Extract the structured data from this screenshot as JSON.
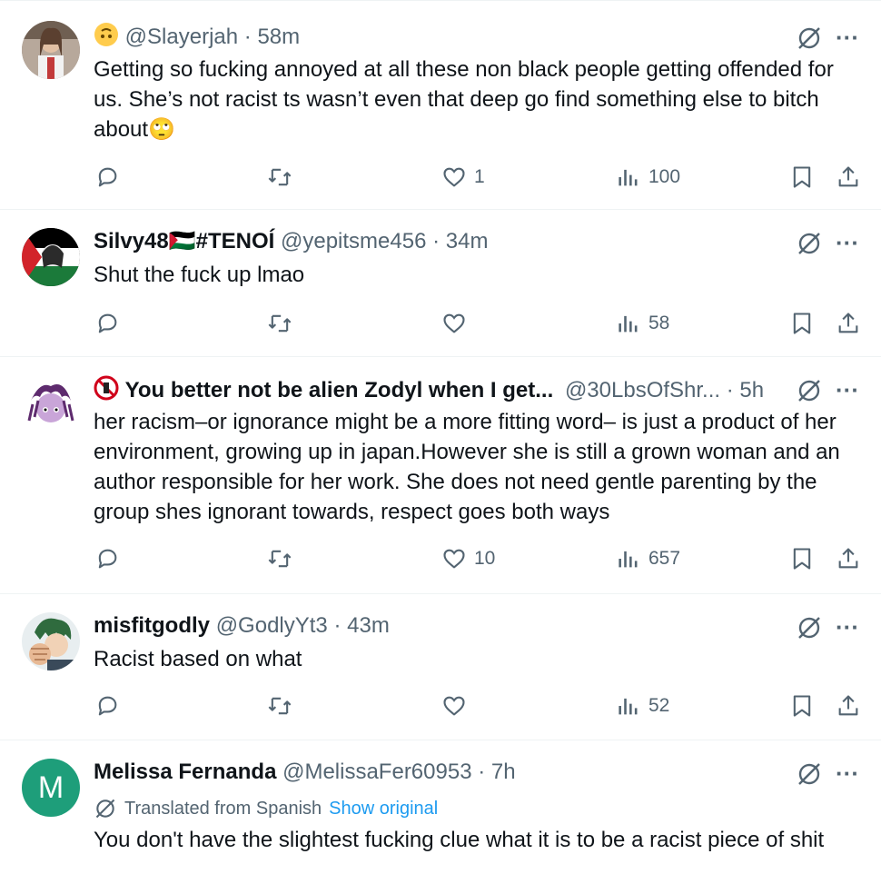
{
  "tweets": [
    {
      "name": "",
      "handle": "@Slayerjah",
      "time": "58m",
      "text": "Getting so fucking annoyed at all these non black people getting offended for us. She’s not racist ts wasn’t even that deep go find something else to bitch about🙄",
      "replies": "",
      "retweets": "",
      "likes": "1",
      "views": "100"
    },
    {
      "name": "Silvy48🇵🇸#TENOÍ",
      "handle": "@yepitsme456",
      "time": "34m",
      "text": "Shut the fuck up lmao",
      "likes": "",
      "views": "58"
    },
    {
      "name": "You better not be alien Zodyl when I get...",
      "handle": "@30LbsOfShr...",
      "time": "5h",
      "text": "her racism–or ignorance might be a more fitting word– is just a product of her environment, growing up in japan.However she is still a grown woman and an author responsible for her work. She does not need gentle parenting by the group shes ignorant towards, respect goes both ways",
      "likes": "10",
      "views": "657"
    },
    {
      "name": "misfitgodly",
      "handle": "@GodlyYt3",
      "time": "43m",
      "text": "Racist based on what",
      "likes": "",
      "views": "52"
    },
    {
      "name": "Melissa Fernanda",
      "handle": "@MelissaFer60953",
      "time": "7h",
      "avatar_letter": "M",
      "translated_label": "Translated from Spanish",
      "show_original": "Show original",
      "text": "You don't have the slightest fucking clue what it is to be a racist piece of shit"
    }
  ],
  "separator": "·",
  "more_glyph": "···",
  "colors": {
    "muted": "#536471",
    "link": "#1d9bf0",
    "text": "#0f1419",
    "avatar_m": "#1e9e7a"
  }
}
